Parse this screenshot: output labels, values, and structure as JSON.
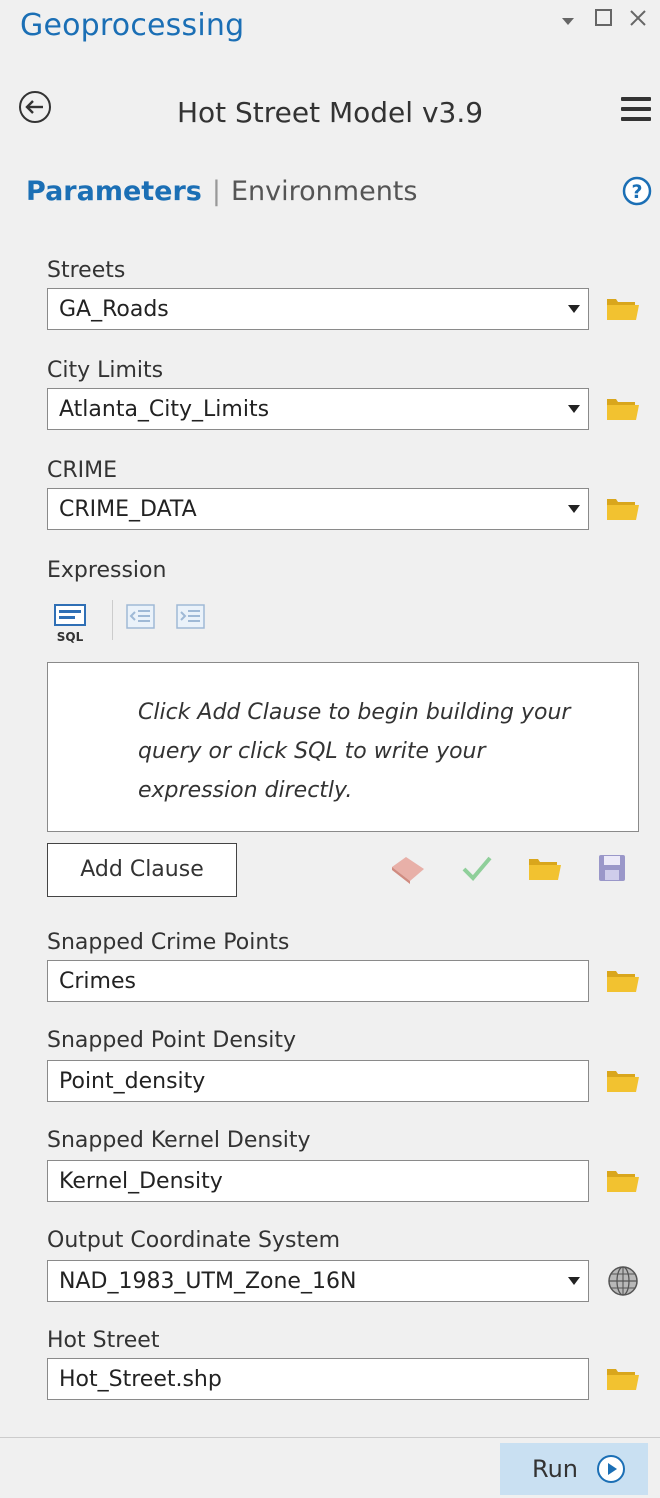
{
  "pane": {
    "title": "Geoprocessing"
  },
  "tool": {
    "title": "Hot Street Model v3.9"
  },
  "tabs": {
    "parameters": "Parameters",
    "environments": "Environments"
  },
  "icons": {
    "back": "back-arrow-icon",
    "menu": "hamburger-menu-icon",
    "help": "help-icon",
    "browse": "folder-icon",
    "coordinate": "globe-icon",
    "sql": "sql-icon",
    "run": "play-icon"
  },
  "params": {
    "streets": {
      "label": "Streets",
      "value": "GA_Roads"
    },
    "city_limits": {
      "label": "City Limits",
      "value": "Atlanta_City_Limits"
    },
    "crime": {
      "label": "CRIME",
      "value": "CRIME_DATA"
    },
    "expression": {
      "label": "Expression",
      "sql_label": "SQL",
      "hint": "Click Add Clause to begin building your query or click SQL to write your expression directly.",
      "add_clause": "Add Clause"
    },
    "snapped_crime_points": {
      "label": "Snapped Crime Points",
      "value": "Crimes"
    },
    "snapped_point_density": {
      "label": "Snapped Point Density",
      "value": "Point_density"
    },
    "snapped_kernel_density": {
      "label": "Snapped Kernel Density",
      "value": "Kernel_Density"
    },
    "output_coordinate_system": {
      "label": "Output Coordinate System",
      "value": "NAD_1983_UTM_Zone_16N"
    },
    "hot_street": {
      "label": "Hot Street",
      "value": "Hot_Street.shp"
    }
  },
  "run": {
    "label": "Run"
  },
  "colors": {
    "accent": "#1b6fb5",
    "folder": "#f2c230",
    "run_bg": "#c9e0f2"
  }
}
